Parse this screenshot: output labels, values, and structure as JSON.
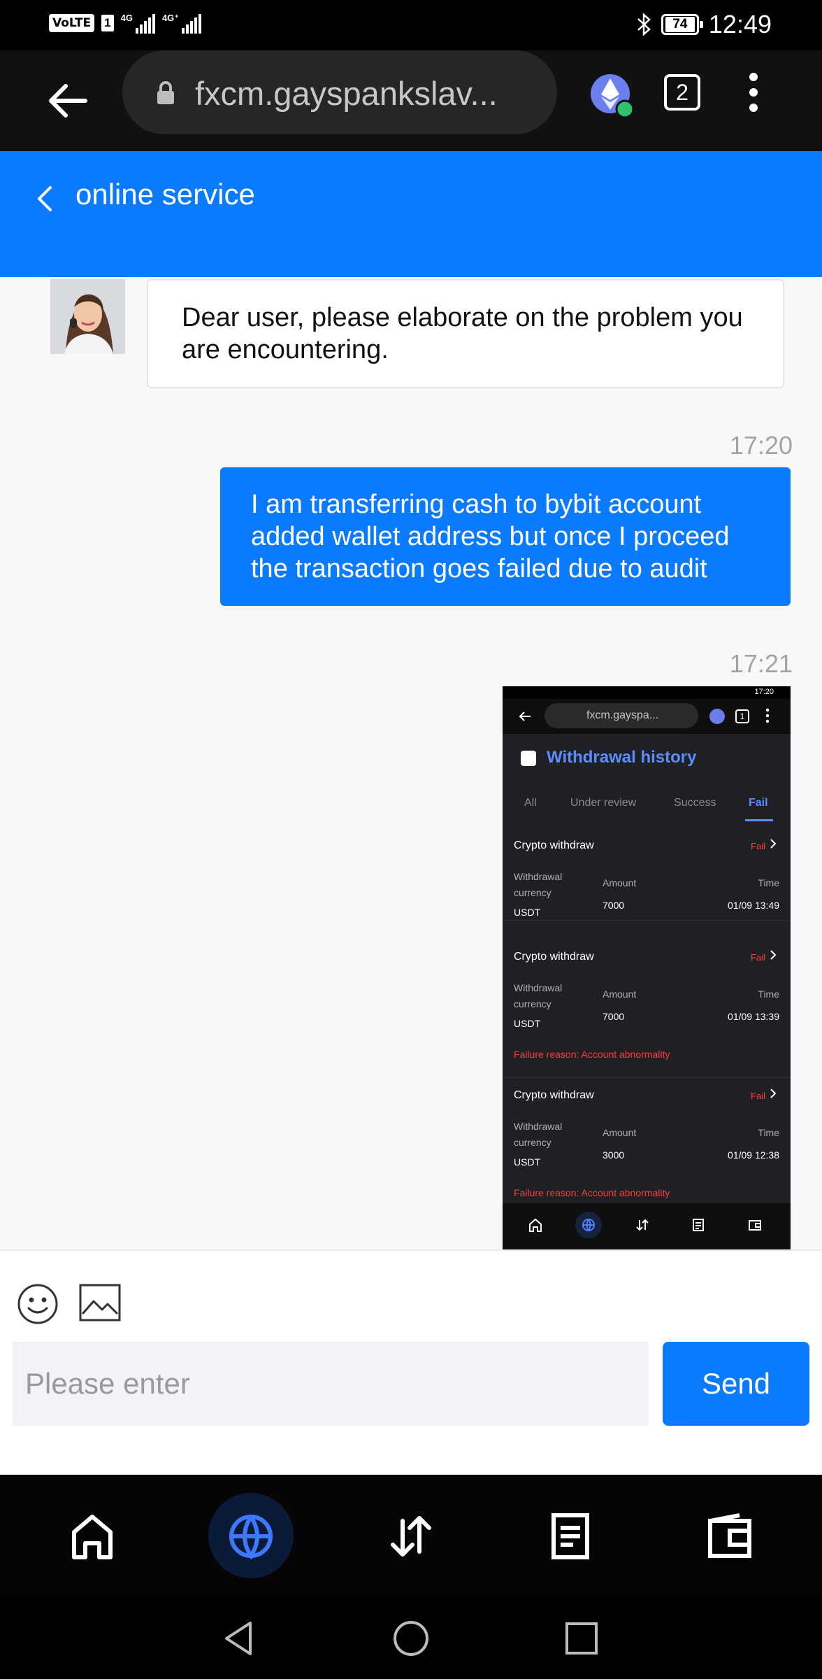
{
  "status_bar": {
    "volte": "VoLTE",
    "sim": "1",
    "net1": "4G",
    "net2": "4G⁺",
    "battery": "74",
    "time": "12:49"
  },
  "browser": {
    "url": "fxcm.gayspankslav...",
    "tabs_count": "2"
  },
  "header": {
    "title": "online service"
  },
  "chat": {
    "messages": [
      {
        "from": "agent",
        "text": "Dear user, please elaborate on the problem you are encountering."
      },
      {
        "from": "user",
        "time": "17:20",
        "text": "I am transferring cash to bybit account added wallet address but once I proceed the transaction goes failed due to audit"
      },
      {
        "from": "user",
        "time": "17:21",
        "type": "image"
      }
    ]
  },
  "screenshot": {
    "status_time": "17:20",
    "url": "fxcm.gayspa...",
    "tab_count": "1",
    "title": "Withdrawal history",
    "tabs": [
      "All",
      "Under review",
      "Success",
      "Fail"
    ],
    "active_tab": "Fail",
    "records": [
      {
        "title": "Crypto withdraw",
        "status": "Fail",
        "currency_label": "Withdrawal currency",
        "currency": "USDT",
        "amount_label": "Amount",
        "amount": "7000",
        "time_label": "Time",
        "time": "01/09 13:49",
        "failure_reason": ""
      },
      {
        "title": "Crypto withdraw",
        "status": "Fail",
        "currency_label": "Withdrawal currency",
        "currency": "USDT",
        "amount_label": "Amount",
        "amount": "7000",
        "time_label": "Time",
        "time": "01/09 13:39",
        "failure_reason": "Failure reason: Account abnormality"
      },
      {
        "title": "Crypto withdraw",
        "status": "Fail",
        "currency_label": "Withdrawal currency",
        "currency": "USDT",
        "amount_label": "Amount",
        "amount": "3000",
        "time_label": "Time",
        "time": "01/09 12:38",
        "failure_reason": "Failure reason: Account abnormality"
      }
    ]
  },
  "input": {
    "placeholder": "Please enter",
    "value": "",
    "send_label": "Send"
  },
  "nav": {
    "items": [
      "home-icon",
      "globe-icon",
      "transfer-icon",
      "document-icon",
      "wallet-icon"
    ],
    "active": "globe-icon"
  },
  "colors": {
    "brand": "#0a7bff",
    "fail": "#ff3b3b",
    "accent_light": "#5a8dff"
  }
}
